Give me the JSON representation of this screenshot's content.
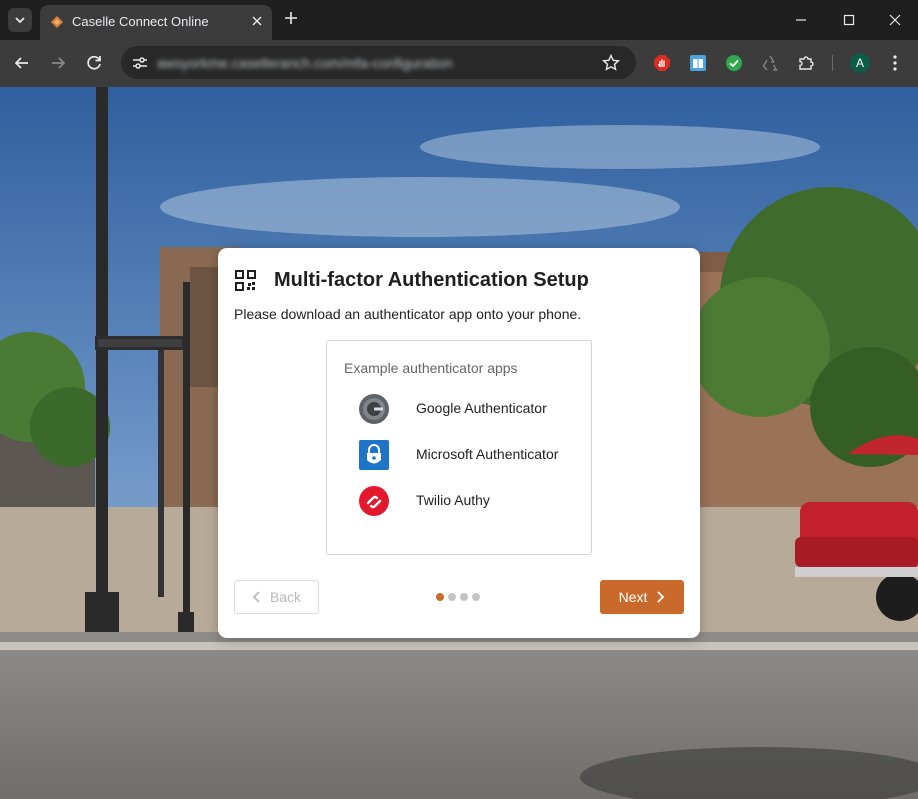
{
  "browser": {
    "tab_title": "Caselle Connect Online",
    "url": "awsyorkme.caselleranch.com/mfa-configuration",
    "profile_initial": "A",
    "colors": {
      "tabbar": "#1f1f1f",
      "toolbar": "#3c3c3c",
      "omnibox": "#282828"
    }
  },
  "icons": {
    "tab_search": "chevron-down-icon",
    "favicon": "caselle-logo-icon",
    "close_tab": "close-icon",
    "new_tab": "plus-icon",
    "minimize": "minimize-icon",
    "maximize": "maximize-icon",
    "close_window": "close-window-icon",
    "back": "arrow-left-icon",
    "forward": "arrow-right-icon",
    "reload": "reload-icon",
    "site_info": "tune-icon",
    "bookmark": "star-icon",
    "extensions": [
      "hand-stop-icon",
      "book-icon",
      "check-circle-icon",
      "recycle-icon",
      "puzzle-icon"
    ],
    "menu": "more-vert-icon"
  },
  "modal": {
    "title": "Multi-factor Authentication Setup",
    "subtitle": "Please download an authenticator app onto your phone.",
    "icon": "qr-code-icon",
    "apps_caption": "Example authenticator apps",
    "apps": [
      {
        "name": "Google Authenticator",
        "icon": "google-authenticator-icon",
        "color": "#5f6368"
      },
      {
        "name": "Microsoft Authenticator",
        "icon": "microsoft-authenticator-icon",
        "color": "#1e74c6"
      },
      {
        "name": "Twilio Authy",
        "icon": "twilio-authy-icon",
        "color": "#e3182d"
      }
    ],
    "back_label": "Back",
    "next_label": "Next",
    "steps_total": 4,
    "current_step": 1,
    "accent_color": "#c96a2c"
  }
}
